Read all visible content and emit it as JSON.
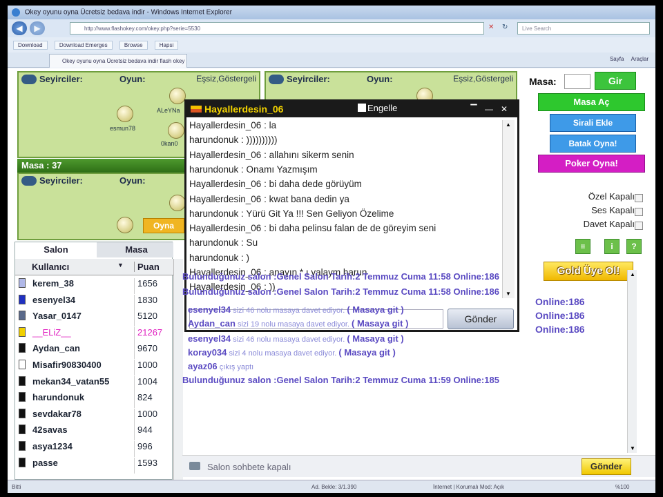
{
  "browser": {
    "title": "Okey oyunu oyna Ücretsiz bedava indir - Windows Internet Explorer",
    "url": "http://www.flashokey.com/okey.php?serie=5530",
    "search_placeholder": "Live Search",
    "links": [
      "Download",
      "Download Emerges",
      "Browse",
      "Hapsi"
    ],
    "tab": "Okey oyunu oyna Ücretsiz bedava indir flash okey",
    "commands": [
      "Sayfa",
      "Araçlar"
    ]
  },
  "tables": [
    {
      "seyirci": "Seyirciler:",
      "oyun": "Oyun:",
      "ess": "Eşsiz,Göstergeli",
      "players": [
        "ALeYNa",
        "esmun78",
        "0kan0"
      ]
    },
    {
      "seyirci": "Seyirciler:",
      "oyun": "Oyun:",
      "ess": "Eşsiz,Göstergeli"
    },
    {
      "seyirci": "Seyirciler:",
      "oyun": "Oyun:",
      "masa": "Masa : 37",
      "oyna": "Oyna"
    }
  ],
  "userpanel": {
    "tab_salon": "Salon",
    "tab_masa": "Masa",
    "col_user": "Kullanıcı",
    "col_points": "Puan",
    "users": [
      {
        "name": "kerem_38",
        "points": "1656",
        "color": "#b0b8e8"
      },
      {
        "name": "esenyel34",
        "points": "1830",
        "color": "#2030c0"
      },
      {
        "name": "Yasar_0147",
        "points": "5120",
        "color": "#5a6a8a"
      },
      {
        "name": "__ELiZ__",
        "points": "21267",
        "color": "#f0d000",
        "highlight": true
      },
      {
        "name": "Aydan_can",
        "points": "9670",
        "color": "#111111"
      },
      {
        "name": "Misafir90830400",
        "points": "1000",
        "color": "#ffffff"
      },
      {
        "name": "mekan34_vatan55",
        "points": "1004",
        "color": "#111111"
      },
      {
        "name": "harundonuk",
        "points": "824",
        "color": "#111111"
      },
      {
        "name": "sevdakar78",
        "points": "1000",
        "color": "#111111"
      },
      {
        "name": "42savas",
        "points": "944",
        "color": "#111111"
      },
      {
        "name": "asya1234",
        "points": "996",
        "color": "#111111"
      },
      {
        "name": "passe",
        "points": "1593",
        "color": "#111111"
      }
    ]
  },
  "right": {
    "masa_label": "Masa:",
    "gir": "Gir",
    "masa_ac": "Masa Aç",
    "sirali": "Sirali Ekle",
    "batak": "Batak Oyna!",
    "poker": "Poker Oyna!",
    "ozel": "Özel Kapalı",
    "ses": "Ses Kapalı",
    "davet": "Davet Kapalı",
    "gold": "Gold Üye Ol!"
  },
  "private_chat": {
    "name": "Hayallerdesin_06",
    "engelle": "Engelle",
    "send": "Gönder",
    "messages": [
      "Hayallerdesin_06 : la",
      "harundonuk : ))))))))))",
      "Hayallerdesin_06 : allahını sikerm senin",
      "harundonuk : Onamı Yazmışım",
      "Hayallerdesin_06 : bi daha dede görüyüm",
      "Hayallerdesin_06 : kwat bana dedin ya",
      "harundonuk : Yürü Git Ya !!! Sen Geliyon Özelime",
      "Hayallerdesin_06 : bi daha pelinsu falan de de göreyim seni",
      "harundonuk : Su",
      "harundonuk : )",
      "Hayallerdesin_06 : anayın * ı yalaym harun",
      "Hayallerdesin_06 : ))"
    ]
  },
  "salon_chat": {
    "online_tail": [
      "Online:186",
      "Online:186",
      "Online:186"
    ],
    "lines": [
      {
        "type": "sys",
        "text": "Bulunduğunuz salon :Genel Salon Tarih:2 Temmuz Cuma 11:58 Online:186"
      },
      {
        "type": "sys",
        "text": "Bulunduğunuz salon :Genel Salon Tarih:2 Temmuz Cuma 11:58 Online:186"
      },
      {
        "type": "inv",
        "user": "esenyel34",
        "msg": " sizi  46  nolu masaya davet ediyor. ",
        "link": "( Masaya git )"
      },
      {
        "type": "inv",
        "user": "Aydan_can",
        "msg": "  sizi  19  nolu masaya davet ediyor. ",
        "link": " ( Masaya git )"
      },
      {
        "type": "inv",
        "user": "esenyel34",
        "msg": "  sizi  46  nolu masaya davet ediyor. ",
        "link": " ( Masaya git )"
      },
      {
        "type": "inv",
        "user": "koray034",
        "msg": "  sizi  4  nolu masaya davet ediyor. ",
        "link": "  ( Masaya git )"
      },
      {
        "type": "exit",
        "user": "ayaz06",
        "msg": "  çıkış yaptı"
      },
      {
        "type": "sys",
        "text": "Bulunduğunuz salon :Genel Salon Tarih:2 Temmuz Cuma 11:59 Online:185"
      }
    ],
    "input_placeholder": "Salon sohbete kapalı",
    "send": "Gönder"
  },
  "status": {
    "left": "Bitti",
    "mid": "Ad. Bekle: 3/1.390",
    "zone": "İnternet | Korumalı Mod: Açık",
    "zoom": "%100"
  }
}
